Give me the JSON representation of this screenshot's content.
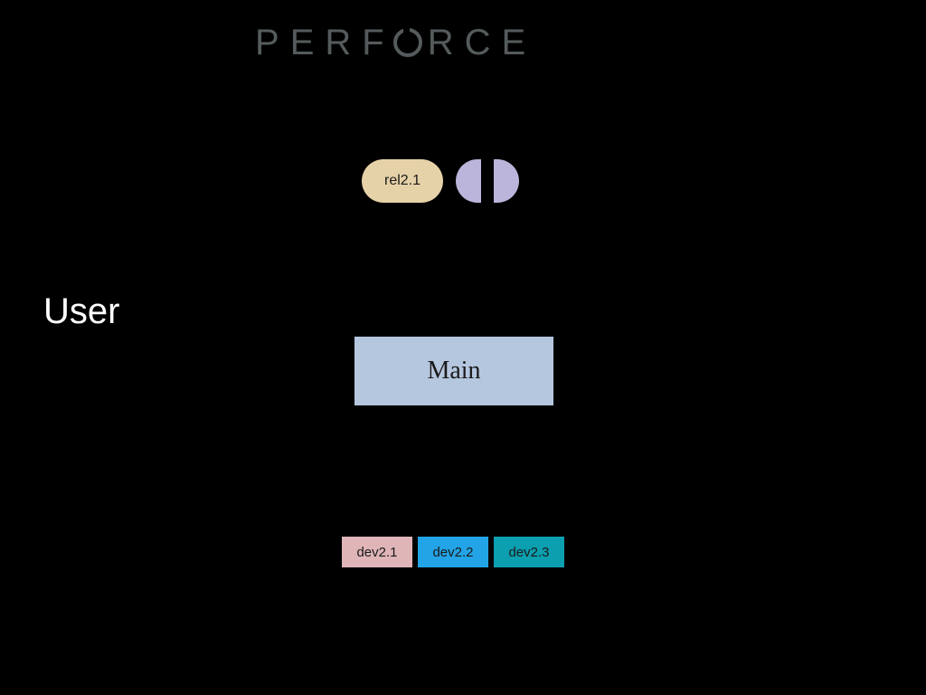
{
  "brand": "PERFORCE",
  "left_label": "User",
  "release_pill": {
    "label": "rel2.1"
  },
  "main_box": {
    "label": "Main"
  },
  "dev_chips": [
    {
      "label": "dev2.1"
    },
    {
      "label": "dev2.2"
    },
    {
      "label": "dev2.3"
    }
  ],
  "colors": {
    "release_pill": "#e6d2a8",
    "half_pills": "#bbb5db",
    "main_box": "#b5c7de",
    "dev1": "#dfb5b8",
    "dev2": "#23a4e6",
    "dev3": "#0b9fb0"
  }
}
